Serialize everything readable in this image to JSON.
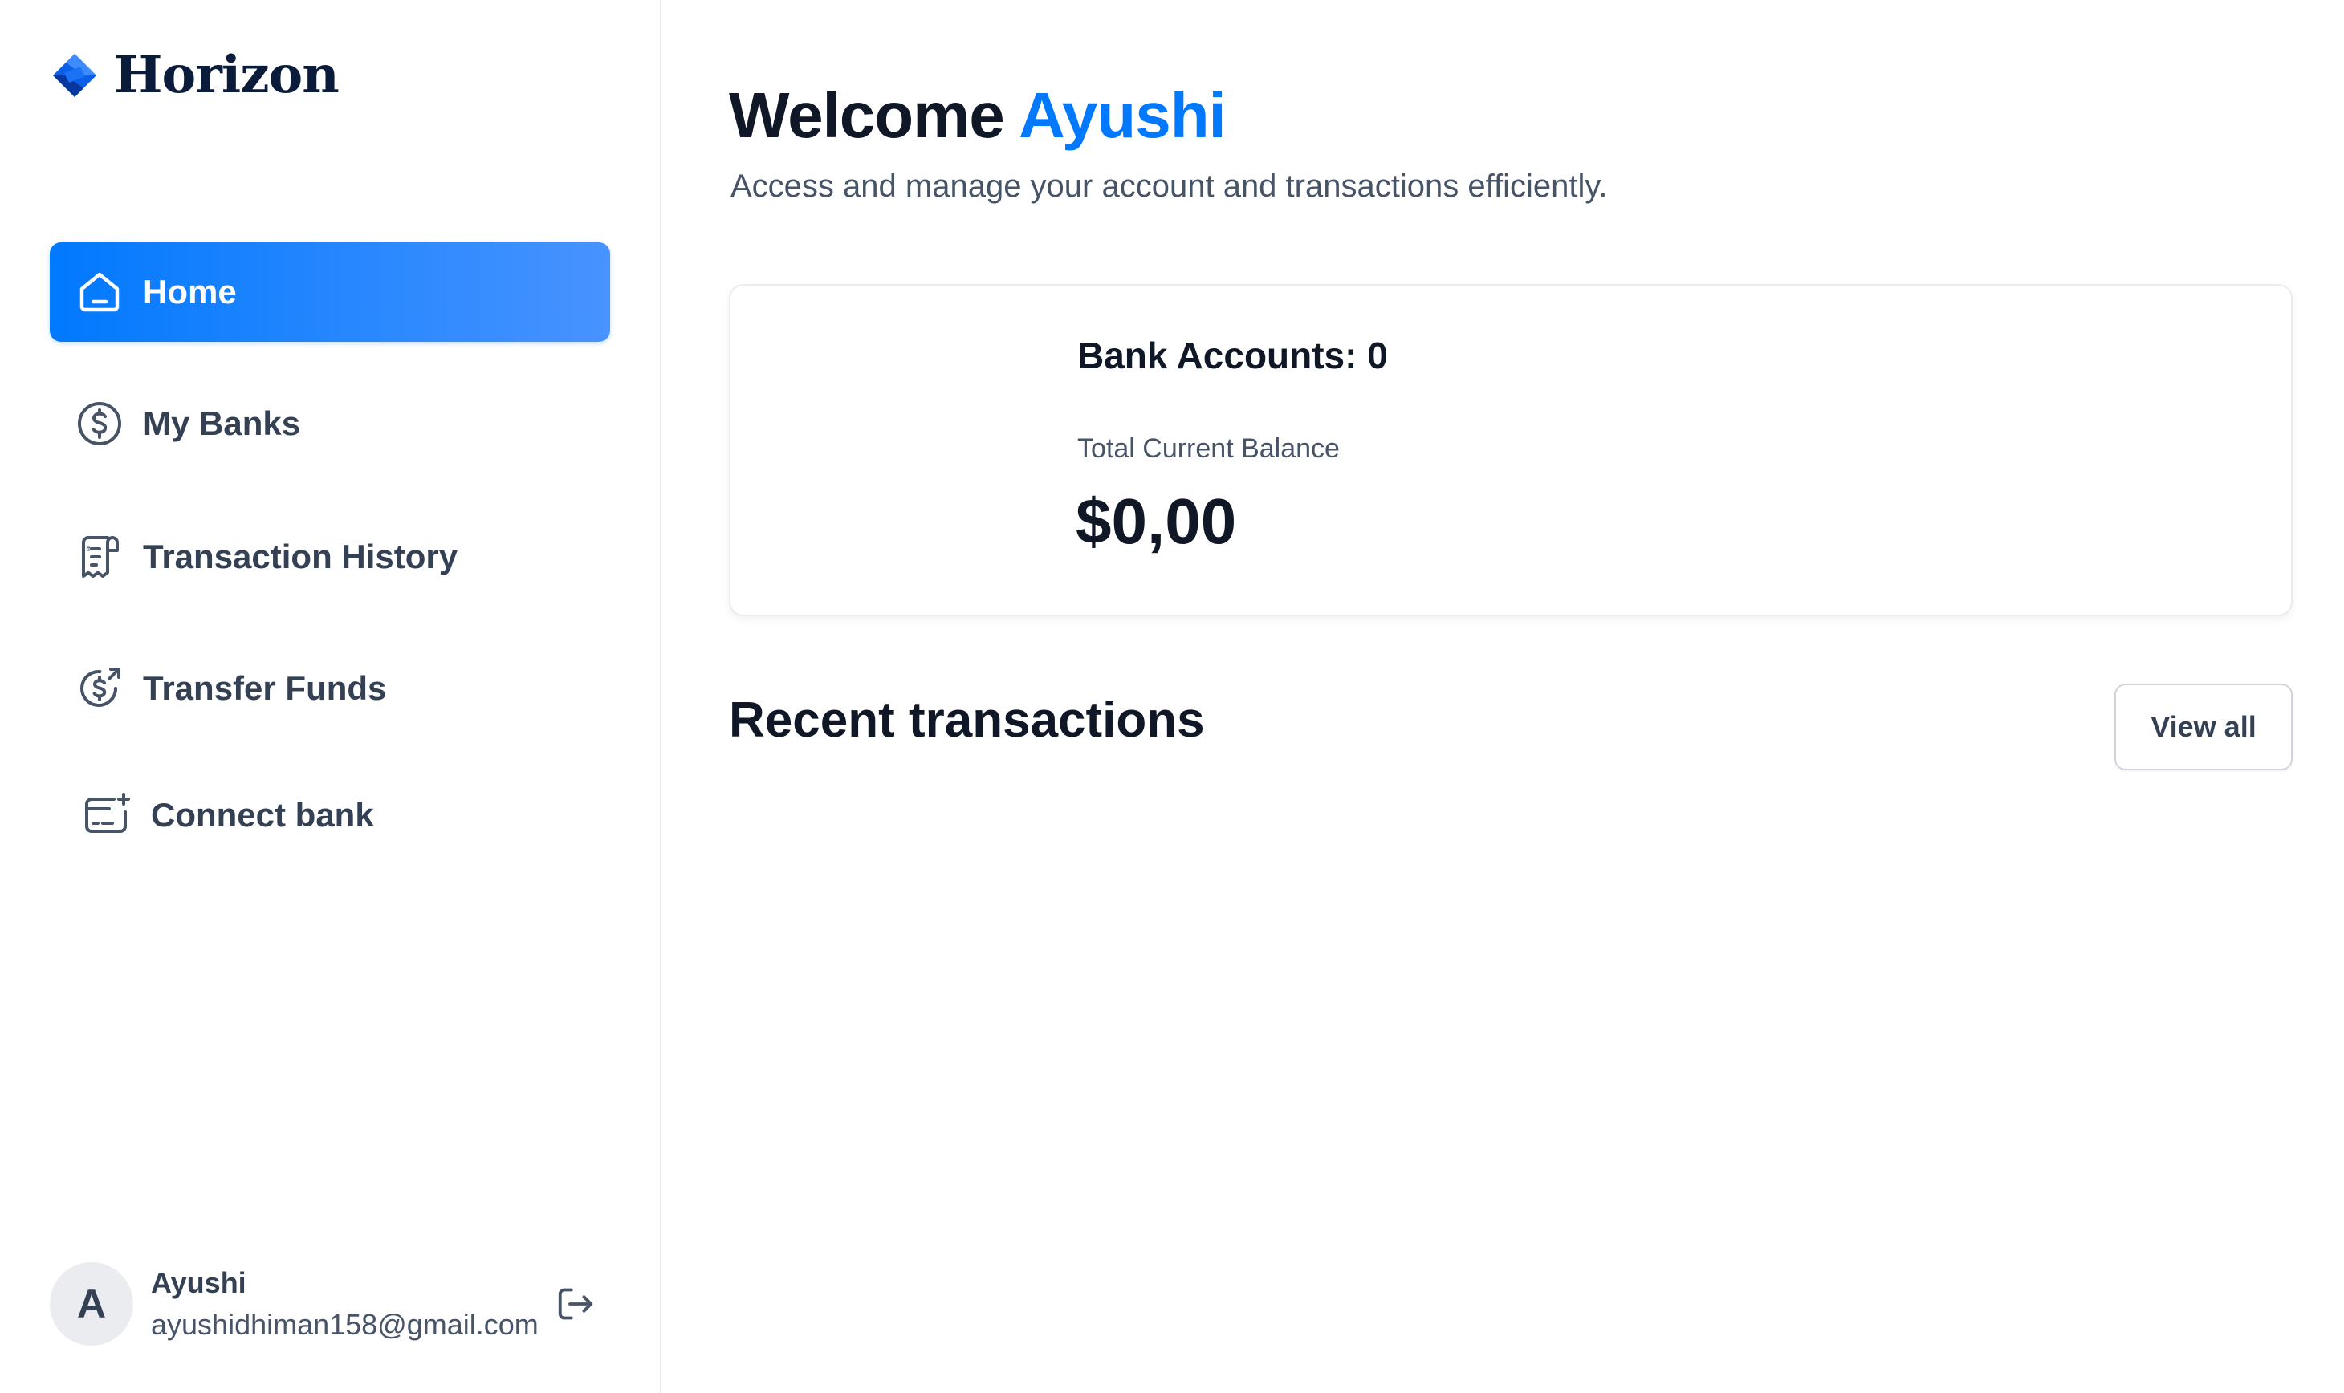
{
  "brand": {
    "name": "Horizon",
    "logo_icon": "horizon-logo-icon"
  },
  "sidebar": {
    "items": [
      {
        "label": "Home",
        "icon": "home-icon",
        "active": true
      },
      {
        "label": "My Banks",
        "icon": "dollar-circle-icon",
        "active": false
      },
      {
        "label": "Transaction History",
        "icon": "receipt-icon",
        "active": false
      },
      {
        "label": "Transfer Funds",
        "icon": "money-send-icon",
        "active": false
      },
      {
        "label": "Connect bank",
        "icon": "card-add-icon",
        "active": false
      }
    ]
  },
  "user": {
    "initial": "A",
    "name": "Ayushi",
    "email": "ayushidhiman158@gmail.com",
    "logout_icon": "logout-icon"
  },
  "header": {
    "greeting": "Welcome",
    "name": "Ayushi",
    "subtitle": "Access and manage your account and transactions efficiently."
  },
  "balance": {
    "bank_accounts_label": "Bank Accounts: 0",
    "total_label": "Total Current Balance",
    "total_value": "$0,00"
  },
  "recent": {
    "title": "Recent transactions",
    "view_all": "View all"
  },
  "colors": {
    "accent": "#0179fe",
    "accent_light": "#4893ff",
    "text_primary": "#101828",
    "text_secondary": "#475467",
    "border": "#eaecf0"
  }
}
